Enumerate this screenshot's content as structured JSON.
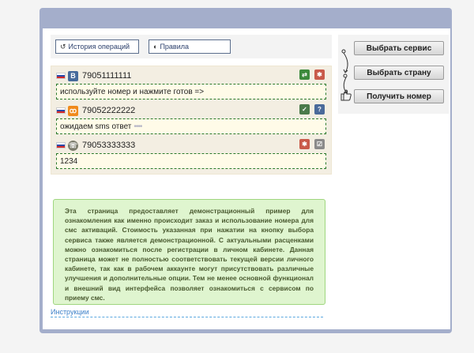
{
  "links": {
    "history": "История операций",
    "rules": "Правила"
  },
  "activations": [
    {
      "number": "79051111111",
      "service_icon": "vk-icon",
      "message": "используйте номер и нажмите готов =>",
      "dots": ""
    },
    {
      "number": "79052222222",
      "service_icon": "odnoklassniki-icon",
      "message": "ожидаем sms ответ",
      "dots": "••••"
    },
    {
      "number": "79053333333",
      "service_icon": "whatsapp-icon",
      "message": "1234",
      "dots": ""
    }
  ],
  "info_text": "Эта страница предоставляет демонстрационный пример для ознакомления как именно происходит заказ и использование номера для смс активаций. Стоимость указанная при нажатии на кнопку выбора сервиса также является демонстрационной. С актуальными расценками можно ознакомиться после регистрации в личном кабинете. Данная страница может не полностью соответствовать текущей версии личного кабинете, так как в рабочем аккаунте могут присутствовать различные улучшения и дополнительные опции. Тем не менее основной функционал и внешний вид интерфейса позволяет ознакомиться с сервисом по приему смс.",
  "instructions": "Инструкции",
  "buttons": {
    "select_service": "Выбрать сервис",
    "select_country": "Выбрать страну",
    "get_number": "Получить номер"
  },
  "colors": {
    "frame": "#a4aecb",
    "activations_bg": "#f3eee2",
    "info_bg": "#dff5cf",
    "link": "#3a7fc8"
  }
}
